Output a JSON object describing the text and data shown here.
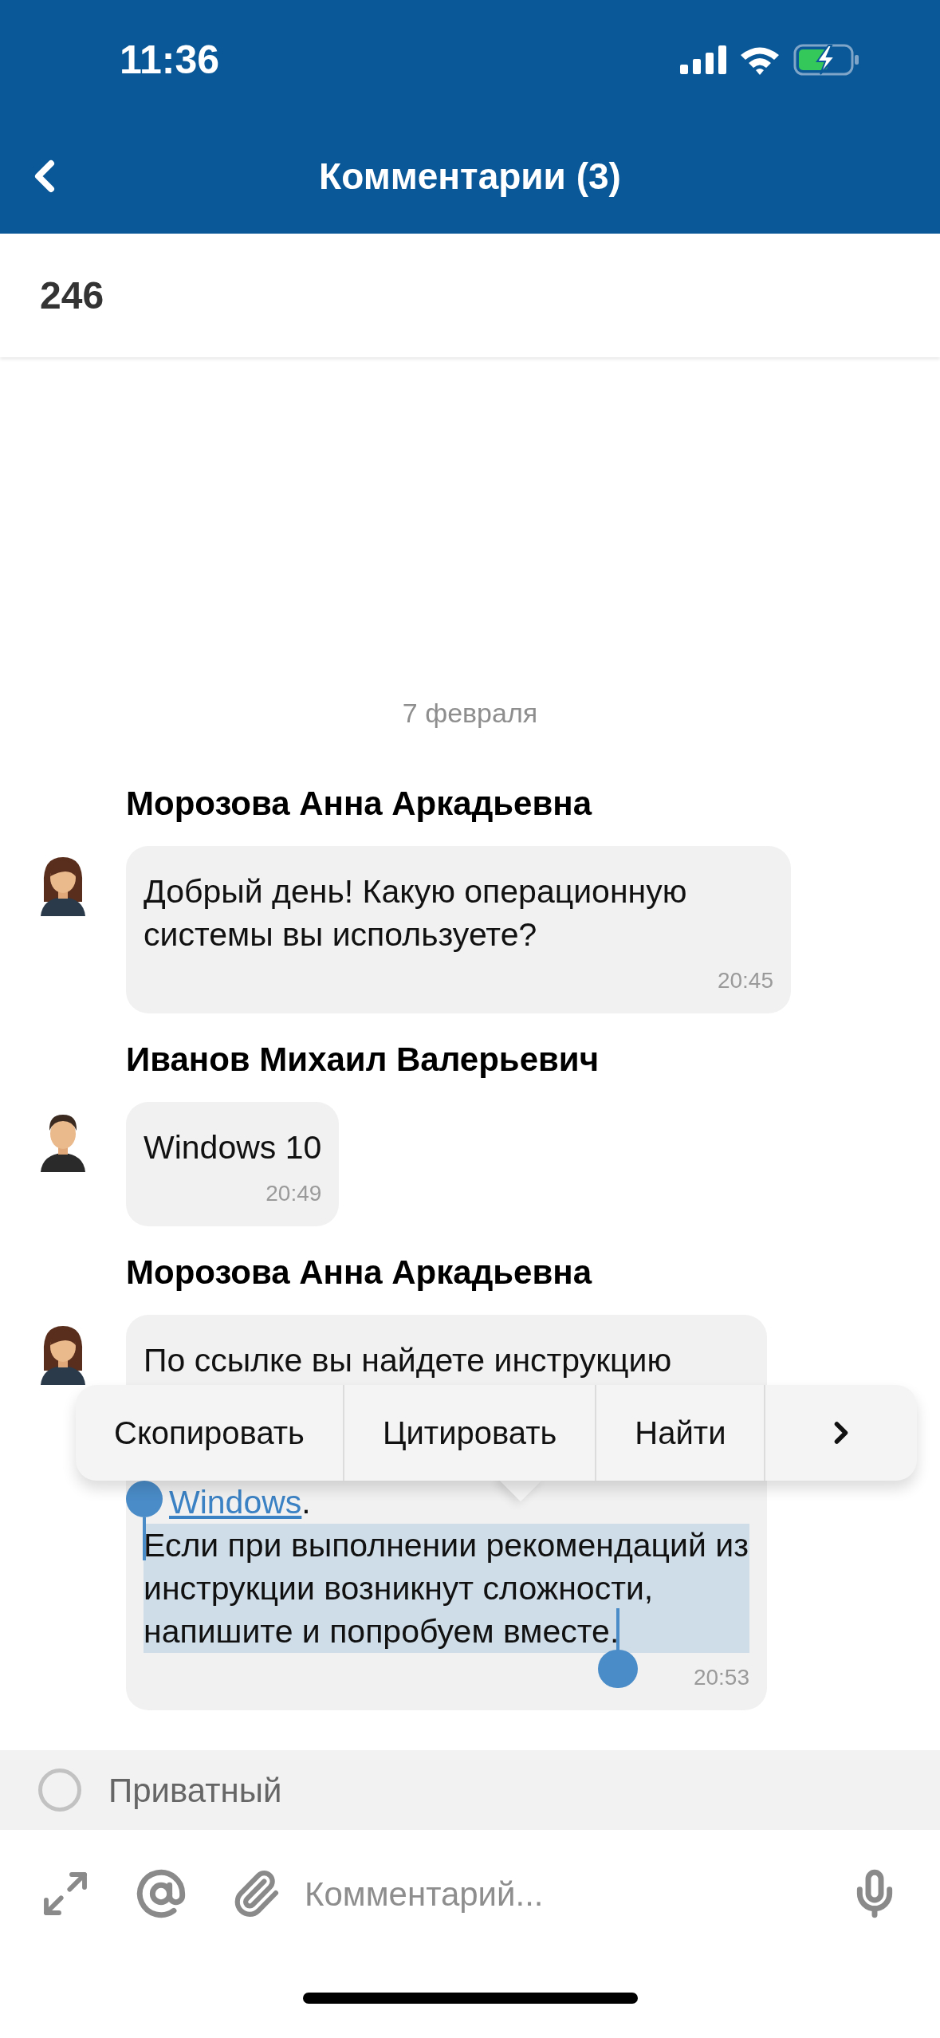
{
  "status_bar": {
    "time": "11:36"
  },
  "nav": {
    "title": "Комментарии (3)"
  },
  "subject": {
    "text": "246"
  },
  "date_divider": "7 февраля",
  "messages": [
    {
      "author": "Морозова Анна Аркадьевна",
      "avatar": {
        "kind": "female"
      },
      "time": "20:45",
      "lines": [
        {
          "kind": "text",
          "text": "Добрый день! Какую операционную системы вы используете?"
        }
      ]
    },
    {
      "author": "Иванов Михаил Валерьевич",
      "avatar": {
        "kind": "male"
      },
      "time": "20:49",
      "lines": [
        {
          "kind": "text",
          "text": "Windows 10"
        }
      ]
    },
    {
      "author": "Морозова Анна Аркадьевна",
      "avatar": {
        "kind": "female"
      },
      "time": "20:53",
      "lines": [
        {
          "kind": "text",
          "text": "По ссылке вы найдете инструкцию"
        },
        {
          "kind": "covered"
        },
        {
          "kind": "link",
          "text": "Windows",
          "suffix": "."
        },
        {
          "kind": "selected",
          "text": "Если при выполнении рекомендаций из инструкции возникнут сложности, напишите и попробуем вместе."
        }
      ]
    }
  ],
  "context_menu": {
    "items": [
      "Скопировать",
      "Цитировать",
      "Найти"
    ],
    "has_more": true
  },
  "private": {
    "label": "Приватный",
    "checked": false
  },
  "composer": {
    "placeholder": "Комментарий..."
  }
}
